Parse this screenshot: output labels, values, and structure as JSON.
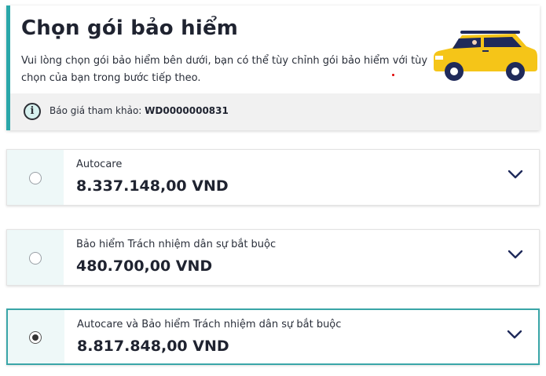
{
  "header": {
    "title": "Chọn gói bảo hiểm",
    "description": "Vui lòng chọn gói bảo hiểm bên dưới, bạn có thể tùy chỉnh gói bảo hiểm với tùy chọn của bạn trong bước tiếp theo.",
    "quote_label": "Báo giá tham khảo:",
    "quote_code": "WD0000000831",
    "illustration_icon": "yellow-car-icon"
  },
  "options": [
    {
      "name": "Autocare",
      "price": "8.337.148,00 VND",
      "selected": false
    },
    {
      "name": "Bảo hiểm Trách nhiệm dân sự bắt buộc",
      "price": "480.700,00 VND",
      "selected": false
    },
    {
      "name": "Autocare và Bảo hiểm Trách nhiệm dân sự bắt buộc",
      "price": "8.817.848,00 VND",
      "selected": true
    }
  ],
  "colors": {
    "accent": "#2aa7a9",
    "radio_cell_bg": "#eef8f8",
    "chevron": "#1f2a5a",
    "car": "#f5c518"
  }
}
